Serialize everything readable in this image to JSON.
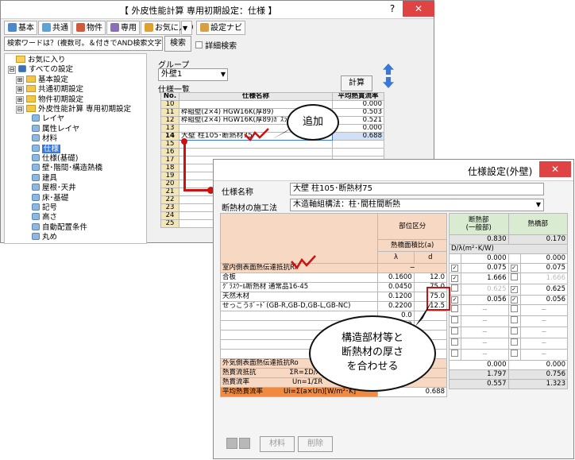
{
  "main": {
    "title": "【 外皮性能計算 専用初期設定：仕様 】",
    "help_label": "?",
    "close_label": "✕",
    "toolbar": {
      "kihon": "基本",
      "kyotsu": "共通",
      "bukken": "物件",
      "senyo": "専用",
      "okiniiri": "お気に入り",
      "dropdown": "▼",
      "navi": "設定ナビ"
    },
    "search": {
      "value": "検索ワードは？(複数可。＆付きでAND検索文字)",
      "button": "検索",
      "detail_label": "詳細検索"
    },
    "tree": [
      {
        "label": "お気に入り",
        "type": "star"
      },
      {
        "label": "すべての設定",
        "type": "root",
        "toggle": "⊟"
      },
      {
        "label": "基本設定",
        "type": "folder",
        "toggle": "⊞"
      },
      {
        "label": "共通初期設定",
        "type": "folder",
        "toggle": "⊞"
      },
      {
        "label": "物件初期設定",
        "type": "folder",
        "toggle": "⊞"
      },
      {
        "label": "外皮性能計算 専用初期設定",
        "type": "folder",
        "toggle": "⊟"
      },
      {
        "label": "レイヤ",
        "type": "leaf"
      },
      {
        "label": "属性レイヤ",
        "type": "leaf"
      },
      {
        "label": "材料",
        "type": "leaf"
      },
      {
        "label": "仕様",
        "type": "leaf",
        "selected": true
      },
      {
        "label": "仕様(基礎)",
        "type": "leaf"
      },
      {
        "label": "壁･階間･構造熱橋",
        "type": "leaf"
      },
      {
        "label": "建具",
        "type": "leaf"
      },
      {
        "label": "屋根･天井",
        "type": "leaf"
      },
      {
        "label": "床･基礎",
        "type": "leaf"
      },
      {
        "label": "記号",
        "type": "leaf"
      },
      {
        "label": "高さ",
        "type": "leaf"
      },
      {
        "label": "自動配置条件",
        "type": "leaf"
      },
      {
        "label": "丸め",
        "type": "leaf"
      }
    ],
    "group_label": "グループ",
    "group_value": "外壁1",
    "list_label": "仕様一覧",
    "calc_button": "計算",
    "list_headers": [
      "No.",
      "仕様名称",
      "平均熱貫流率"
    ],
    "list_rows": [
      {
        "no": "10",
        "name": "",
        "val": "0.000"
      },
      {
        "no": "11",
        "name": "枠組壁(2×4) HGW16K(厚89)",
        "val": "0.503"
      },
      {
        "no": "12",
        "name": "枠組壁(2×4) HGW16K(厚89)ｶﾞｽﾗ",
        "val": "0.521"
      },
      {
        "no": "13",
        "name": "",
        "val": "0.000"
      },
      {
        "no": "14",
        "name": "大壁 柱105･断熱材75",
        "val": "0.688",
        "selected": true
      },
      {
        "no": "15",
        "name": "",
        "val": ""
      },
      {
        "no": "16",
        "name": "",
        "val": ""
      },
      {
        "no": "17",
        "name": "",
        "val": ""
      },
      {
        "no": "18",
        "name": "",
        "val": ""
      },
      {
        "no": "19",
        "name": "",
        "val": ""
      },
      {
        "no": "20",
        "name": "",
        "val": ""
      },
      {
        "no": "21",
        "name": "",
        "val": ""
      },
      {
        "no": "22",
        "name": "",
        "val": ""
      },
      {
        "no": "23",
        "name": "",
        "val": ""
      },
      {
        "no": "24",
        "name": "",
        "val": ""
      },
      {
        "no": "25",
        "name": "",
        "val": ""
      }
    ],
    "callout_add": "追加"
  },
  "dialog": {
    "title": "仕様設定(外壁)",
    "close_label": "✕",
    "name_label": "仕様名称",
    "name_value": "大壁 柱105･断熱材75",
    "method_label": "断熱材の施工法",
    "method_value": "木造軸組構法：柱･間柱間断熱",
    "col_bui": "部位区分",
    "col_dannetsu": "断熱部\n(一般部)",
    "col_netsukyo": "熱橋部",
    "col_menseki": "熱橋面積比(a)",
    "col_lambda": "λ",
    "col_d": "d",
    "area_dannetsu": "0.830",
    "area_netsukyo": "0.170",
    "unit_label": "D/λ(m²･K/W)",
    "dash": "−",
    "layers": [
      {
        "name": "室内側表面熱伝達抵抗Ri",
        "lambda": "",
        "d": "",
        "v1": "0.000",
        "c1": false,
        "v2": "0.000",
        "c2": false,
        "inner": true
      },
      {
        "name": "合板",
        "lambda": "0.1600",
        "d": "12.0",
        "v1": "0.075",
        "c1": true,
        "v2": "0.075",
        "c2": true
      },
      {
        "name": "ｸﾞﾗｽｳｰﾙ断熱材 通常品16-45",
        "lambda": "0.0450",
        "d": "75.0",
        "v1": "1.666",
        "c1": true,
        "v2": "1.666",
        "c2": false,
        "v2gray": true
      },
      {
        "name": "天然木材",
        "lambda": "0.1200",
        "d": "75.0",
        "v1": "0.625",
        "c1": false,
        "v2": "0.625",
        "c2": true,
        "v1gray": true
      },
      {
        "name": "せっこうﾎﾞｰﾄﾞ(GB-R,GB-D,GB-L,GB-NC)",
        "lambda": "0.2200",
        "d": "12.5",
        "v1": "0.056",
        "c1": true,
        "v2": "0.056",
        "c2": true
      },
      {
        "name": "",
        "lambda": "0.0",
        "d": "",
        "v1": "−",
        "c1": false,
        "v2": "−",
        "c2": false
      },
      {
        "name": "",
        "lambda": "0.0",
        "d": "",
        "v1": "−",
        "c1": false,
        "v2": "−",
        "c2": false
      },
      {
        "name": "",
        "lambda": "",
        "d": "",
        "v1": "−",
        "c1": false,
        "v2": "−",
        "c2": false
      },
      {
        "name": "",
        "lambda": "",
        "d": "",
        "v1": "−",
        "c1": false,
        "v2": "−",
        "c2": false
      },
      {
        "name": "",
        "lambda": "",
        "d": "",
        "v1": "−",
        "c1": false,
        "v2": "−",
        "c2": false
      }
    ],
    "outer_label": "外気側表面熱伝達抵抗Ro",
    "outer_v1": "0.000",
    "outer_v2": "0.000",
    "resist_label": "熱貫流抵抗",
    "resist_formula": "ΣR=ΣD/λ",
    "resist_v1": "1.797",
    "resist_v2": "0.756",
    "ratio_label": "熱貫流率",
    "ratio_formula": "Un=1/ΣR",
    "ratio_v1": "0.557",
    "ratio_v2": "1.323",
    "avg_label": "平均熱貫流率",
    "avg_formula": "Ui=Σ(a×Un)[W/m²･K]",
    "avg_value": "0.688",
    "btn_material": "材料",
    "btn_delete": "削除",
    "callout_text_1": "構造部材等と",
    "callout_text_2": "断熱材の厚さ",
    "callout_text_3": "を合わせる"
  },
  "colors": {
    "accent_red": "#cc1111",
    "highlight": "#f7d8c3",
    "selected": "#3a78d8"
  }
}
